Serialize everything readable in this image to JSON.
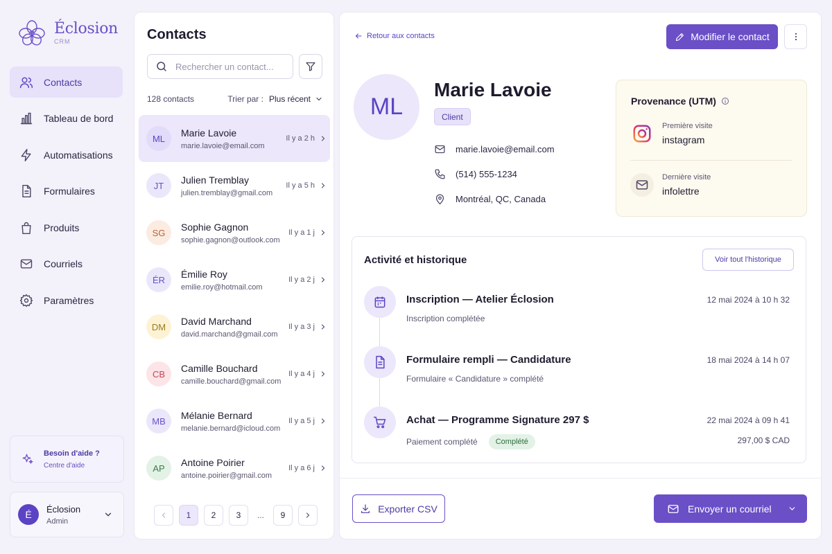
{
  "app": {
    "name": "Éclosion",
    "sub": "CRM"
  },
  "nav": [
    {
      "label": "Contacts",
      "icon": "users-icon",
      "active": true
    },
    {
      "label": "Tableau de bord",
      "icon": "bar-chart-icon"
    },
    {
      "label": "Automatisations",
      "icon": "lightning-icon"
    },
    {
      "label": "Formulaires",
      "icon": "document-icon"
    },
    {
      "label": "Produits",
      "icon": "shopping-bag-icon"
    },
    {
      "label": "Courriels",
      "icon": "mail-icon"
    },
    {
      "label": "Paramètres",
      "icon": "gear-icon"
    }
  ],
  "help": {
    "title": "Besoin d'aide ?",
    "subtitle": "Centre d'aide"
  },
  "user": {
    "initial": "É",
    "name": "Éclosion",
    "role": "Admin"
  },
  "contacts": {
    "title": "Contacts",
    "search_placeholder": "Rechercher un contact...",
    "count": "128 contacts",
    "sort_label": "Trier par :",
    "sort_value": "Plus récent",
    "items": [
      {
        "initials": "ML",
        "name": "Marie Lavoie",
        "email": "marie.lavoie@email.com",
        "time": "Il y a 2 h",
        "bg": "#e2dbf9",
        "fg": "#5b43c4",
        "selected": true
      },
      {
        "initials": "JT",
        "name": "Julien Tremblay",
        "email": "julien.tremblay@gmail.com",
        "time": "Il y a 5 h",
        "bg": "#ebe7fb",
        "fg": "#6a4fc7"
      },
      {
        "initials": "SG",
        "name": "Sophie Gagnon",
        "email": "sophie.gagnon@outlook.com",
        "time": "Il y a 1 j",
        "bg": "#fcebe0",
        "fg": "#b7643a"
      },
      {
        "initials": "ÉR",
        "name": "Émilie Roy",
        "email": "emilie.roy@hotmail.com",
        "time": "Il y a 2 j",
        "bg": "#ebe7fb",
        "fg": "#6a4fc7"
      },
      {
        "initials": "DM",
        "name": "David Marchand",
        "email": "david.marchand@gmail.com",
        "time": "Il y a 3 j",
        "bg": "#fdf3d4",
        "fg": "#9d7a1c"
      },
      {
        "initials": "CB",
        "name": "Camille Bouchard",
        "email": "camille.bouchard@gmail.com",
        "time": "Il y a 4 j",
        "bg": "#fde4e6",
        "fg": "#c0475a"
      },
      {
        "initials": "MB",
        "name": "Mélanie Bernard",
        "email": "melanie.bernard@icloud.com",
        "time": "Il y a 5 j",
        "bg": "#ebe7fb",
        "fg": "#6a4fc7"
      },
      {
        "initials": "AP",
        "name": "Antoine Poirier",
        "email": "antoine.poirier@gmail.com",
        "time": "Il y a 6 j",
        "bg": "#e3f2e6",
        "fg": "#3c7a48"
      }
    ],
    "pagination": [
      "1",
      "2",
      "3",
      "...",
      "9"
    ]
  },
  "detail": {
    "back_label": "Retour aux contacts",
    "edit_label": "Modifier le contact",
    "initials": "ML",
    "name": "Marie Lavoie",
    "badge": "Client",
    "email": "marie.lavoie@email.com",
    "phone": "(514) 555-1234",
    "location": "Montréal, QC, Canada",
    "utm": {
      "title": "Provenance (UTM)",
      "first_label": "Première visite",
      "first_value": "instagram",
      "last_label": "Dernière visite",
      "last_value": "infolettre"
    },
    "activity": {
      "title": "Activité et historique",
      "history_button": "Voir tout l'historique",
      "events": [
        {
          "icon": "calendar-icon",
          "title": "Inscription — Atelier Éclosion",
          "desc": "Inscription complétée",
          "date": "12 mai 2024 à 10 h 32"
        },
        {
          "icon": "document-icon",
          "title": "Formulaire rempli — Candidature",
          "desc": "Formulaire « Candidature » complété",
          "date": "18 mai 2024 à 14 h 07"
        },
        {
          "icon": "cart-icon",
          "title": "Achat — Programme Signature 297 $",
          "desc": "Paiement complété",
          "status": "Complété",
          "date": "22 mai 2024 à 09 h 41",
          "amount": "297,00 $ CAD"
        }
      ]
    },
    "export_label": "Exporter CSV",
    "send_label": "Envoyer un courriel"
  }
}
